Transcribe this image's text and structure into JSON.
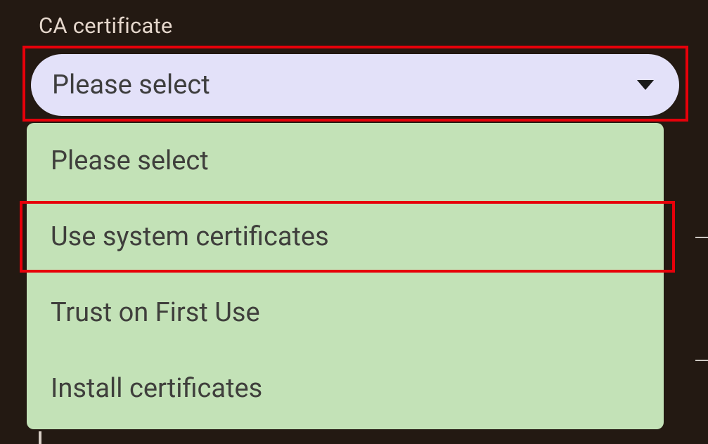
{
  "field": {
    "label": "CA certificate"
  },
  "select": {
    "value": "Please select"
  },
  "options": [
    {
      "label": "Please select"
    },
    {
      "label": "Use system certificates"
    },
    {
      "label": "Trust on First Use"
    },
    {
      "label": "Install certificates"
    }
  ],
  "highlights": {
    "select_box": true,
    "option_index": 1
  }
}
